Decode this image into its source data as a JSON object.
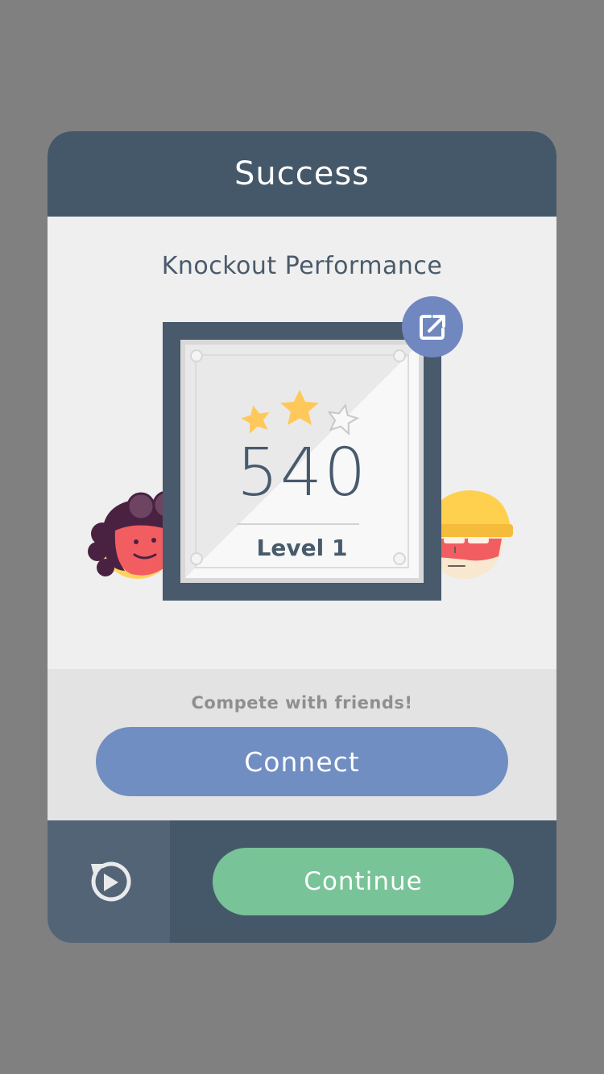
{
  "dialog": {
    "title": "Success",
    "subtitle": "Knockout Performance"
  },
  "scorecard": {
    "score": "540",
    "level": "Level 1",
    "stars_earned": 2,
    "stars_total": 3,
    "star_color": "#ffc85a"
  },
  "share": {
    "icon": "share-icon"
  },
  "social": {
    "prompt": "Compete with friends!",
    "connect_label": "Connect"
  },
  "footer": {
    "replay_icon": "replay-icon",
    "continue_label": "Continue"
  },
  "colors": {
    "header": "#455869",
    "connect": "#708ec1",
    "continue": "#78c398",
    "share": "#7087c0"
  }
}
